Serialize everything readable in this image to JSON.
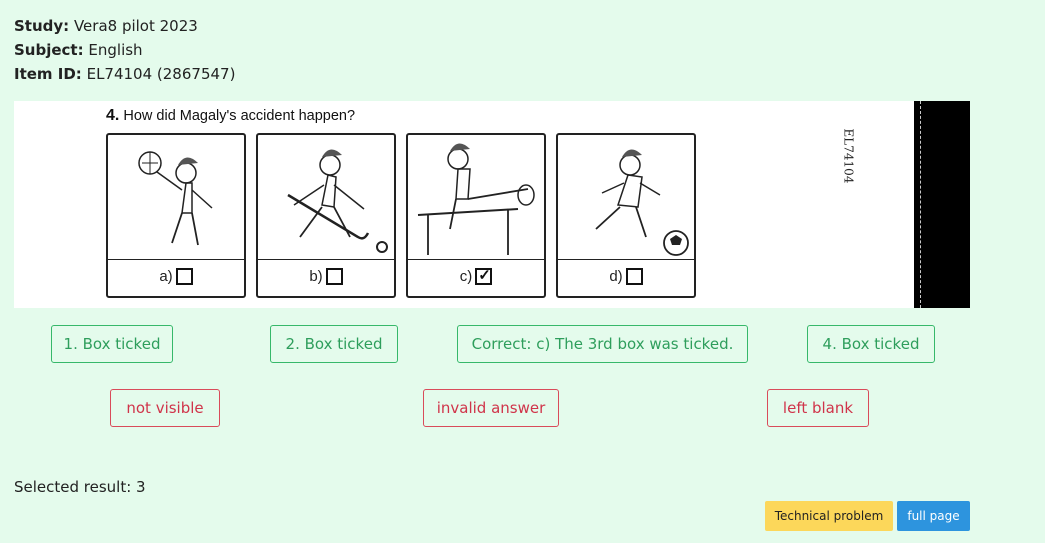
{
  "meta": {
    "study_label": "Study:",
    "study_value": "Vera8 pilot 2023",
    "subject_label": "Subject:",
    "subject_value": "English",
    "item_label": "Item ID:",
    "item_value": "EL74104 (2867547)"
  },
  "scan": {
    "question_number": "4.",
    "question_text": "How did Magaly's accident happen?",
    "side_id": "EL74104",
    "choices": [
      {
        "letter": "a)",
        "ticked": false
      },
      {
        "letter": "b)",
        "ticked": false
      },
      {
        "letter": "c)",
        "ticked": true
      },
      {
        "letter": "d)",
        "ticked": false
      }
    ]
  },
  "result_buttons": [
    {
      "label": "1. Box ticked"
    },
    {
      "label": "2. Box ticked"
    },
    {
      "label": "Correct: c) The 3rd box was ticked."
    },
    {
      "label": "4. Box ticked"
    }
  ],
  "status_buttons": [
    {
      "label": "not visible"
    },
    {
      "label": "invalid answer"
    },
    {
      "label": "left blank"
    }
  ],
  "selected_result": "Selected result: 3",
  "actions": {
    "technical_problem": "Technical problem",
    "full_page": "full page"
  },
  "colors": {
    "background": "#e4fbec",
    "green": "#2e9e5c",
    "red": "#d0344a",
    "yellow": "#fcd75a",
    "blue": "#2d94de"
  }
}
